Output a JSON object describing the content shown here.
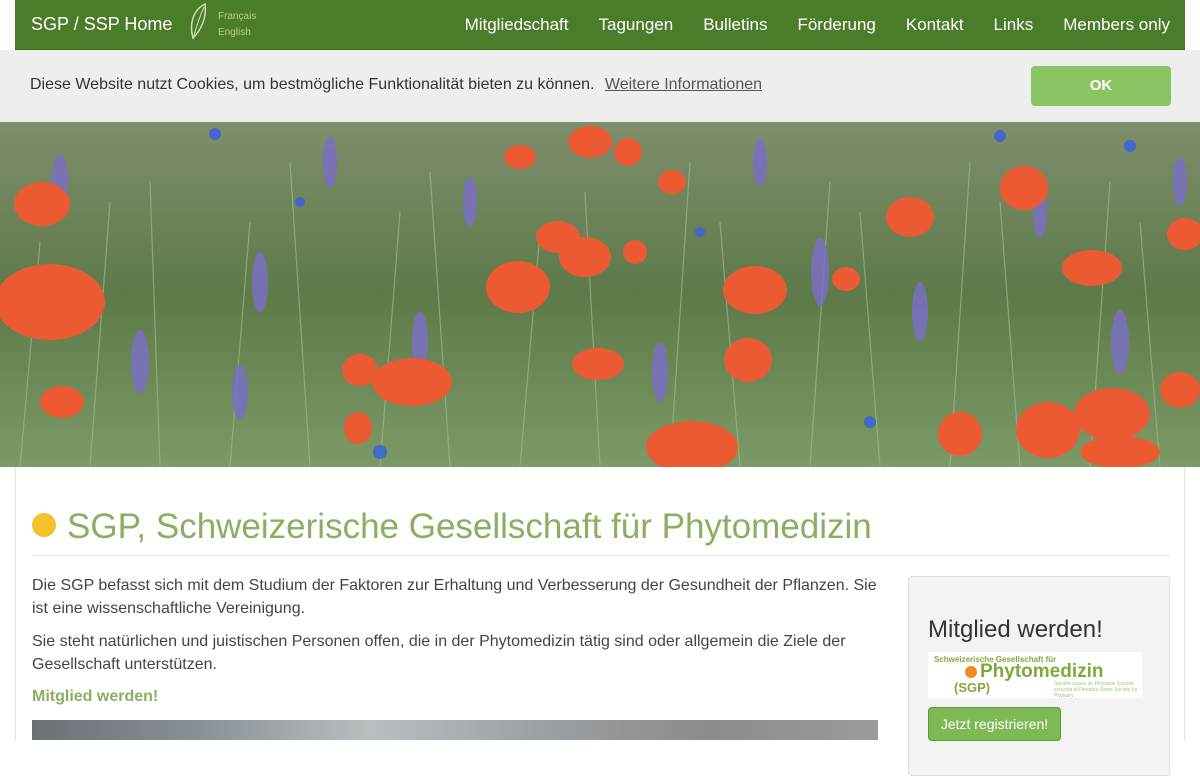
{
  "nav": {
    "brand": "SGP / SSP Home",
    "lang_fr": "Français",
    "lang_en": "English",
    "links": [
      "Mitgliedschaft",
      "Tagungen",
      "Bulletins",
      "Förderung",
      "Kontakt",
      "Links",
      "Members only"
    ]
  },
  "cookie": {
    "message": "Diese Website nutzt Cookies, um bestmögliche Funktionalität bieten zu können.",
    "more_link": "Weitere Informationen",
    "ok_label": "OK"
  },
  "hero": {
    "icon": "poppy-meadow-photo"
  },
  "main": {
    "title": "SGP, Schweizerische Gesellschaft für Phytomedizin",
    "paragraph1": "Die SGP befasst sich mit dem Studium der Faktoren zur Erhaltung und Verbesserung der Gesundheit der Pflanzen. Sie ist eine wissenschaftliche Vereinigung.",
    "paragraph2": "Sie steht natürlichen und juistischen Personen offen, die in der Phytomedizin tätig sind oder allgemein die Ziele der Gesellschaft unterstützen.",
    "cta_link": "Mitglied werden!"
  },
  "sidebar": {
    "heading": "Mitglied werden!",
    "logo_small": "Schweizerische Gesellschaft für",
    "logo_big": "Phytomedizin",
    "logo_abbr": "(SGP)",
    "logo_tiny": "Société suisse de Phytiatrie Società svizzera di Fitoiatria Swiss Society for Phytiatry",
    "register_label": "Jetzt registrieren!"
  },
  "colors": {
    "nav_green": "#4b7c2a",
    "accent_green": "#8aaf62",
    "button_green": "#8bc463",
    "title_dot": "#f7c12b"
  }
}
